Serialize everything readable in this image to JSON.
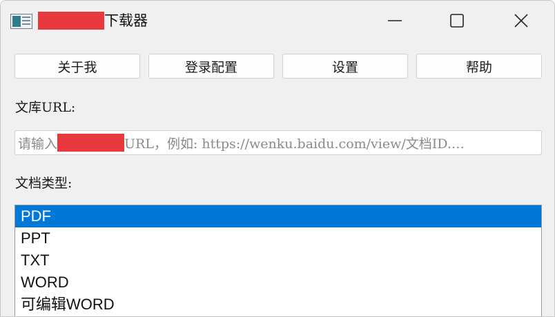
{
  "window": {
    "title_redacted": "██████",
    "title": "下载器"
  },
  "toolbar": {
    "buttons": [
      "关于我",
      "登录配置",
      "设置",
      "帮助"
    ]
  },
  "url": {
    "label": "文库URL:",
    "placeholder_prefix": "请输入",
    "placeholder_redacted": "██████",
    "placeholder_suffix": "URL，例如: https://wenku.baidu.com/view/文档ID.…"
  },
  "doc_type": {
    "label": "文档类型:",
    "options": [
      "PDF",
      "PPT",
      "TXT",
      "WORD",
      "可编辑WORD"
    ],
    "selected": "PDF"
  },
  "colors": {
    "selection": "#0078d7",
    "redaction": "#e8393f",
    "background": "#f0f0f0"
  }
}
